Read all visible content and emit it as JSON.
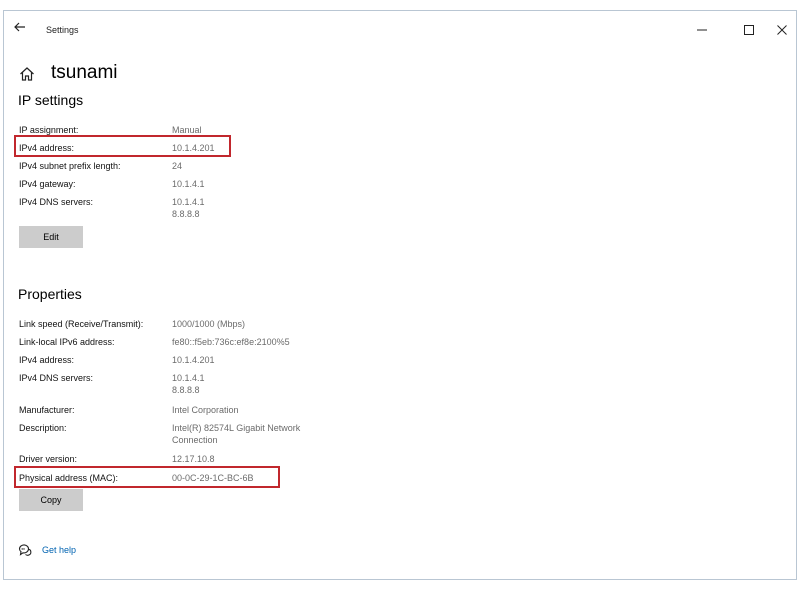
{
  "window": {
    "title": "Settings"
  },
  "page": {
    "title": "tsunami"
  },
  "ip_settings": {
    "heading": "IP settings",
    "rows": [
      {
        "label": "IP assignment:",
        "value": [
          "Manual"
        ]
      },
      {
        "label": "IPv4 address:",
        "value": [
          "10.1.4.201"
        ]
      },
      {
        "label": "IPv4 subnet prefix length:",
        "value": [
          "24"
        ]
      },
      {
        "label": "IPv4 gateway:",
        "value": [
          "10.1.4.1"
        ]
      },
      {
        "label": "IPv4 DNS servers:",
        "value": [
          "10.1.4.1",
          "8.8.8.8"
        ]
      }
    ],
    "edit_label": "Edit"
  },
  "properties": {
    "heading": "Properties",
    "rows": [
      {
        "label": "Link speed (Receive/Transmit):",
        "value": [
          "1000/1000 (Mbps)"
        ]
      },
      {
        "label": "Link-local IPv6 address:",
        "value": [
          "fe80::f5eb:736c:ef8e:2100%5"
        ]
      },
      {
        "label": "IPv4 address:",
        "value": [
          "10.1.4.201"
        ]
      },
      {
        "label": "IPv4 DNS servers:",
        "value": [
          "10.1.4.1",
          "8.8.8.8"
        ]
      },
      {
        "label": "Manufacturer:",
        "value": [
          "Intel Corporation"
        ]
      },
      {
        "label": "Description:",
        "value": [
          "Intel(R) 82574L Gigabit Network",
          "Connection"
        ]
      },
      {
        "label": "Driver version:",
        "value": [
          "12.17.10.8"
        ]
      },
      {
        "label": "Physical address (MAC):",
        "value": [
          "00-0C-29-1C-BC-6B"
        ]
      }
    ],
    "copy_label": "Copy"
  },
  "help": {
    "label": "Get help"
  },
  "colors": {
    "highlight": "#c1272d",
    "link": "#0063b1",
    "button": "#cccccc",
    "value_text": "#6b6b6b"
  },
  "icons": [
    "back-arrow-icon",
    "minimize-icon",
    "maximize-icon",
    "close-icon",
    "home-icon",
    "help-chat-icon"
  ]
}
